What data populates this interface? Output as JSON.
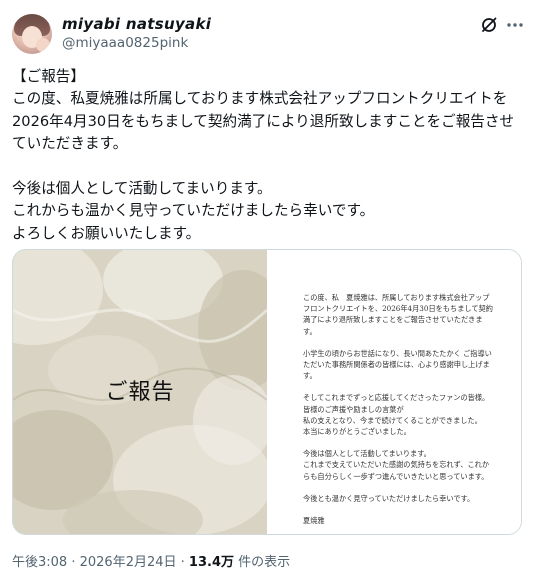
{
  "author": {
    "display_name": "miyabi natsuyaki",
    "handle": "@miyaaa0825pink"
  },
  "tweet": {
    "text": "【ご報告】\nこの度、私夏焼雅は所属しております株式会社アップフロントクリエイトを2026年4月30日をもちまして契約満了により退所致しますことをご報告させていただきます。\n\n今後は個人として活動してまいります。\nこれからも温かく見守っていただけましたら幸いです。\nよろしくお願いいたします。"
  },
  "media": {
    "left_title": "ご報告",
    "doc_paragraphs": [
      "この度、私　夏焼雅は、所属しております株式会社アップフロントクリエイトを、2026年4月30日をもちまして契約満了により退所致しますことをご報告させていただきます。",
      "小学生の頃からお世話になり、長い間あたたかく ご指導いただいた事務所関係者の皆様には、心より感謝申し上げます。",
      "そしてこれまでずっと応援してくださったファンの皆様。\n皆様のご声援や励ましの言葉が\n私の支えとなり、今まで続けてくることができました。\n本当にありがとうございました。",
      "今後は個人として活動してまいります。\nこれまで支えていただいた感謝の気持ちを忘れず、これからも自分らしく一歩ずつ進んでいきたいと思っています。",
      "今後とも温かく見守っていただけましたら幸いです。"
    ],
    "signature": "夏焼雅"
  },
  "meta": {
    "time": "午後3:08",
    "separator": " · ",
    "date": "2026年2月24日",
    "views_count": "13.4万",
    "views_label": " 件の表示"
  },
  "icons": {
    "grok": "grok-icon",
    "more": "more-dots-icon"
  }
}
